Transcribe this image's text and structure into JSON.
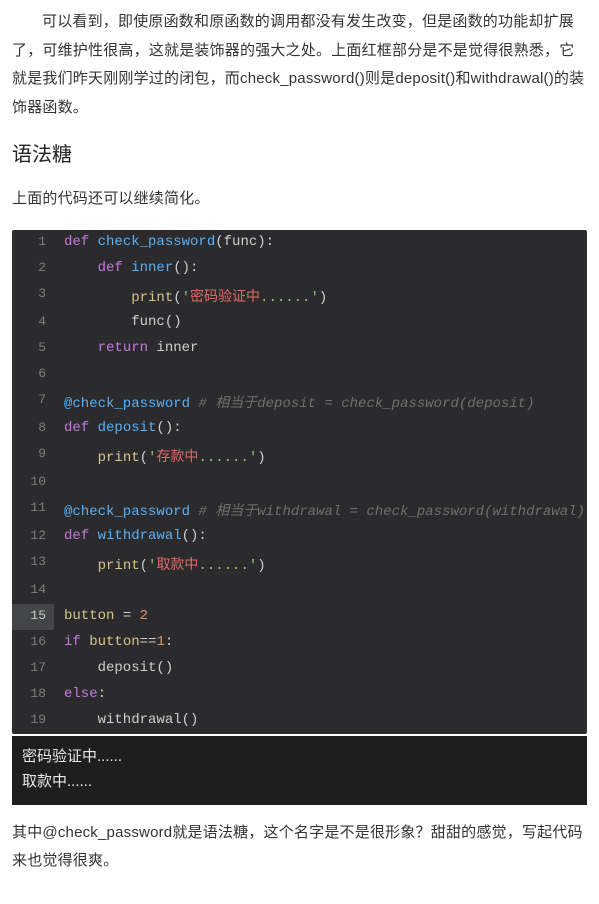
{
  "intro_para": "可以看到，即使原函数和原函数的调用都没有发生改变，但是函数的功能却扩展了，可维护性很高，这就是装饰器的强大之处。上面红框部分是不是觉得很熟悉，它就是我们昨天刚刚学过的闭包，而check_password()则是deposit()和withdrawal()的装饰器函数。",
  "heading": "语法糖",
  "lead_para": "上面的代码还可以继续简化。",
  "code": {
    "lines": [
      {
        "n": "1",
        "kind": "code",
        "segs": [
          {
            "c": "tok-def",
            "t": "def "
          },
          {
            "c": "tok-fn",
            "t": "check_password"
          },
          {
            "c": "tok-plain",
            "t": "(func):"
          }
        ]
      },
      {
        "n": "2",
        "kind": "code",
        "segs": [
          {
            "c": "tok-plain",
            "t": "    "
          },
          {
            "c": "tok-def",
            "t": "def "
          },
          {
            "c": "tok-fn",
            "t": "inner"
          },
          {
            "c": "tok-plain",
            "t": "():"
          }
        ]
      },
      {
        "n": "3",
        "kind": "code",
        "segs": [
          {
            "c": "tok-plain",
            "t": "        "
          },
          {
            "c": "tok-builtin",
            "t": "print"
          },
          {
            "c": "tok-plain",
            "t": "("
          },
          {
            "c": "tok-str",
            "t": "'"
          },
          {
            "c": "tok-str-cn",
            "t": "密码验证中"
          },
          {
            "c": "tok-str",
            "t": "......'"
          },
          {
            "c": "tok-plain",
            "t": ")"
          }
        ]
      },
      {
        "n": "4",
        "kind": "code",
        "segs": [
          {
            "c": "tok-plain",
            "t": "        func()"
          }
        ]
      },
      {
        "n": "5",
        "kind": "code",
        "segs": [
          {
            "c": "tok-plain",
            "t": "    "
          },
          {
            "c": "tok-kw",
            "t": "return"
          },
          {
            "c": "tok-plain",
            "t": " inner"
          }
        ]
      },
      {
        "n": "6",
        "kind": "blank",
        "segs": []
      },
      {
        "n": "7",
        "kind": "code",
        "segs": [
          {
            "c": "tok-dec",
            "t": "@check_password"
          },
          {
            "c": "tok-plain",
            "t": " "
          },
          {
            "c": "tok-cm",
            "t": "# 相当于deposit = check_password(deposit)"
          }
        ]
      },
      {
        "n": "8",
        "kind": "code",
        "segs": [
          {
            "c": "tok-def",
            "t": "def "
          },
          {
            "c": "tok-fn",
            "t": "deposit"
          },
          {
            "c": "tok-plain",
            "t": "():"
          }
        ]
      },
      {
        "n": "9",
        "kind": "code",
        "segs": [
          {
            "c": "tok-plain",
            "t": "    "
          },
          {
            "c": "tok-builtin",
            "t": "print"
          },
          {
            "c": "tok-plain",
            "t": "("
          },
          {
            "c": "tok-str",
            "t": "'"
          },
          {
            "c": "tok-str-cn",
            "t": "存款中"
          },
          {
            "c": "tok-str",
            "t": "......'"
          },
          {
            "c": "tok-plain",
            "t": ")"
          }
        ]
      },
      {
        "n": "10",
        "kind": "blank",
        "segs": []
      },
      {
        "n": "11",
        "kind": "code",
        "segs": [
          {
            "c": "tok-dec",
            "t": "@check_password"
          },
          {
            "c": "tok-plain",
            "t": " "
          },
          {
            "c": "tok-cm",
            "t": "# 相当于withdrawal = check_password(withdrawal)"
          }
        ]
      },
      {
        "n": "12",
        "kind": "code",
        "segs": [
          {
            "c": "tok-def",
            "t": "def "
          },
          {
            "c": "tok-fn",
            "t": "withdrawal"
          },
          {
            "c": "tok-plain",
            "t": "():"
          }
        ]
      },
      {
        "n": "13",
        "kind": "code",
        "segs": [
          {
            "c": "tok-plain",
            "t": "    "
          },
          {
            "c": "tok-builtin",
            "t": "print"
          },
          {
            "c": "tok-plain",
            "t": "("
          },
          {
            "c": "tok-str",
            "t": "'"
          },
          {
            "c": "tok-str-cn",
            "t": "取款中"
          },
          {
            "c": "tok-str",
            "t": "......'"
          },
          {
            "c": "tok-plain",
            "t": ")"
          }
        ]
      },
      {
        "n": "14",
        "kind": "blank",
        "segs": []
      },
      {
        "n": "15",
        "kind": "code",
        "hl": true,
        "segs": [
          {
            "c": "tok-id",
            "t": "button"
          },
          {
            "c": "tok-plain",
            "t": " = "
          },
          {
            "c": "tok-num",
            "t": "2"
          }
        ]
      },
      {
        "n": "16",
        "kind": "code",
        "segs": [
          {
            "c": "tok-kw",
            "t": "if"
          },
          {
            "c": "tok-plain",
            "t": " "
          },
          {
            "c": "tok-id",
            "t": "button"
          },
          {
            "c": "tok-plain",
            "t": "=="
          },
          {
            "c": "tok-num",
            "t": "1"
          },
          {
            "c": "tok-plain",
            "t": ":"
          }
        ]
      },
      {
        "n": "17",
        "kind": "code",
        "segs": [
          {
            "c": "tok-plain",
            "t": "    deposit()"
          }
        ]
      },
      {
        "n": "18",
        "kind": "code",
        "segs": [
          {
            "c": "tok-kw",
            "t": "else"
          },
          {
            "c": "tok-plain",
            "t": ":"
          }
        ]
      },
      {
        "n": "19",
        "kind": "code",
        "segs": [
          {
            "c": "tok-plain",
            "t": "    withdrawal()"
          }
        ]
      }
    ]
  },
  "output": {
    "lines": [
      "密码验证中......",
      "取款中......"
    ]
  },
  "outro_para": "其中@check_password就是语法糖，这个名字是不是很形象？甜甜的感觉，写起代码来也觉得很爽。"
}
